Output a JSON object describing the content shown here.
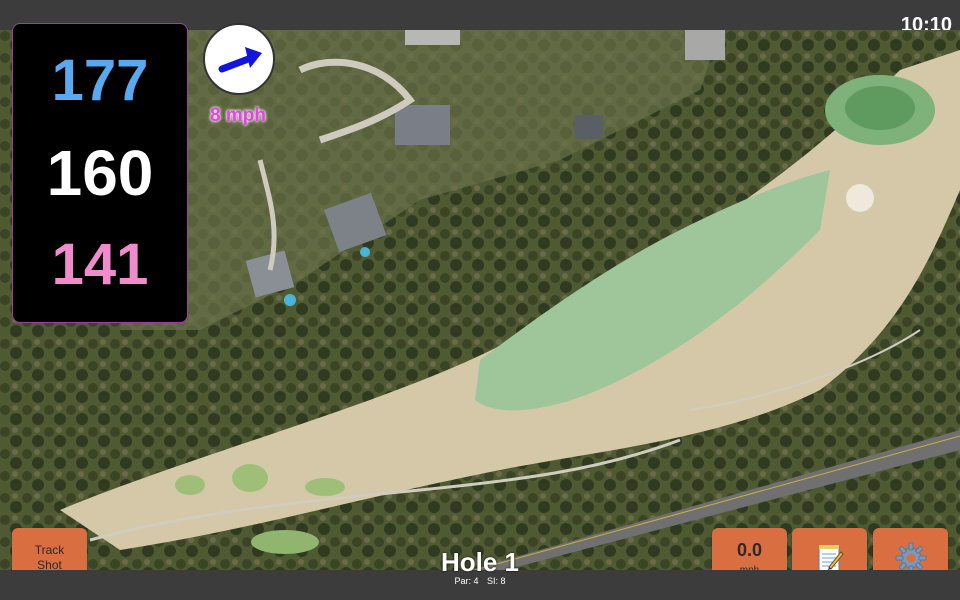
{
  "status_bar": {
    "time": "10:10"
  },
  "distances": {
    "back": "177",
    "middle": "160",
    "front": "141"
  },
  "wind": {
    "speed": "8 mph",
    "arrow_icon": "wind-arrow-icon",
    "arrow_color": "#1414e0"
  },
  "buttons": {
    "track_shot_line1": "Track",
    "track_shot_line2": "Shot",
    "speed_value": "0.0",
    "speed_unit": "mph",
    "notes_icon": "notepad-icon",
    "settings_icon": "gear-icon"
  },
  "hole": {
    "title": "Hole 1",
    "par": "Par: 4",
    "si": "SI: 8"
  },
  "colors": {
    "button": "#d96e40",
    "back_distance": "#5aa8f0",
    "middle_distance": "#ffffff",
    "front_distance": "#f08ccc",
    "wind_label": "#e245e0"
  }
}
